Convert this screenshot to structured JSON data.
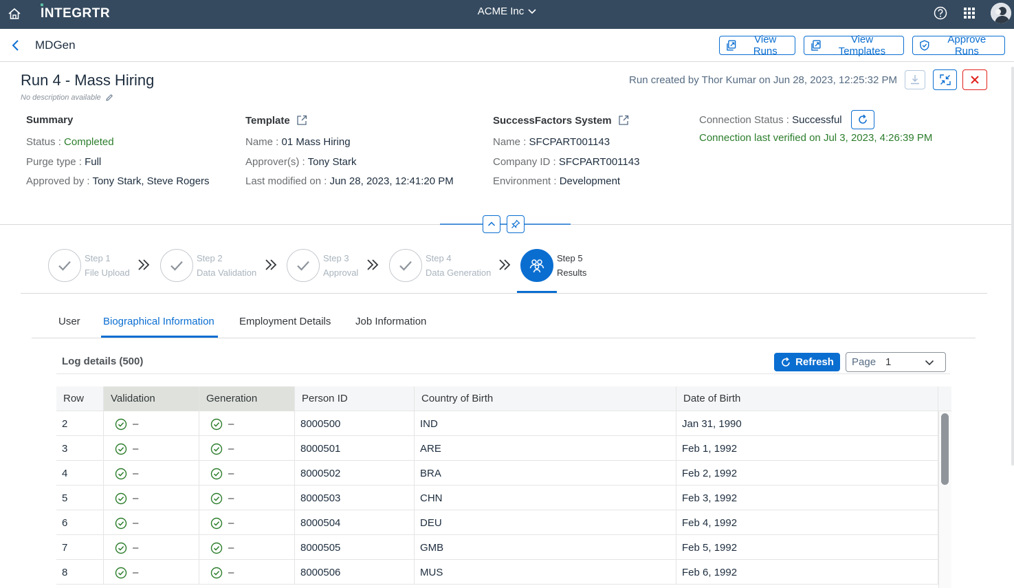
{
  "shell": {
    "brand": "INTEGRTR",
    "tenant": "ACME Inc"
  },
  "subheader": {
    "app_title": "MDGen",
    "buttons": {
      "view_runs": "View Runs",
      "view_templates": "View Templates",
      "approve_runs": "Approve Runs"
    }
  },
  "run": {
    "title": "Run 4 - Mass Hiring",
    "description": "No description available",
    "created": "Run created by Thor Kumar on Jun 28, 2023, 12:25:32 PM"
  },
  "summary": {
    "title": "Summary",
    "status_label": "Status :",
    "status_value": "Completed",
    "purge_label": "Purge type :",
    "purge_value": "Full",
    "approved_label": "Approved by :",
    "approved_value": "Tony Stark, Steve Rogers"
  },
  "template": {
    "title": "Template",
    "name_label": "Name :",
    "name_value": "01 Mass Hiring",
    "approvers_label": "Approver(s) :",
    "approvers_value": "Tony Stark",
    "modified_label": "Last modified on :",
    "modified_value": "Jun 28, 2023, 12:41:20 PM"
  },
  "system": {
    "title": "SuccessFactors System",
    "name_label": "Name :",
    "name_value": "SFCPART001143",
    "company_label": "Company ID :",
    "company_value": "SFCPART001143",
    "env_label": "Environment :",
    "env_value": "Development"
  },
  "connection": {
    "label": "Connection Status :",
    "value": "Successful",
    "verified": "Connection last verified on Jul 3, 2023, 4:26:39 PM"
  },
  "steps": [
    {
      "num": "Step 1",
      "name": "File Upload",
      "state": "done"
    },
    {
      "num": "Step 2",
      "name": "Data Validation",
      "state": "done"
    },
    {
      "num": "Step 3",
      "name": "Approval",
      "state": "done"
    },
    {
      "num": "Step 4",
      "name": "Data Generation",
      "state": "done"
    },
    {
      "num": "Step 5",
      "name": "Results",
      "state": "active"
    }
  ],
  "tabs": [
    {
      "label": "User"
    },
    {
      "label": "Biographical Information",
      "active": true
    },
    {
      "label": "Employment Details"
    },
    {
      "label": "Job Information"
    }
  ],
  "log": {
    "title": "Log details (500)",
    "refresh": "Refresh",
    "page_label": "Page",
    "page_value": "1"
  },
  "table": {
    "headers": [
      "Row",
      "Validation",
      "Generation",
      "Person ID",
      "Country of Birth",
      "Date of Birth"
    ],
    "dash": "–",
    "rows": [
      {
        "row": "2",
        "person_id": "8000500",
        "country": "IND",
        "dob": "Jan 31, 1990"
      },
      {
        "row": "3",
        "person_id": "8000501",
        "country": "ARE",
        "dob": "Feb 1, 1992"
      },
      {
        "row": "4",
        "person_id": "8000502",
        "country": "BRA",
        "dob": "Feb 2, 1992"
      },
      {
        "row": "5",
        "person_id": "8000503",
        "country": "CHN",
        "dob": "Feb 3, 1992"
      },
      {
        "row": "6",
        "person_id": "8000504",
        "country": "DEU",
        "dob": "Feb 4, 1992"
      },
      {
        "row": "7",
        "person_id": "8000505",
        "country": "GMB",
        "dob": "Feb 5, 1992"
      },
      {
        "row": "8",
        "person_id": "8000506",
        "country": "MUS",
        "dob": "Feb 6, 1992"
      }
    ]
  },
  "colors": {
    "shell": "#354a5f",
    "accent": "#0a6ed1",
    "success": "#2b7d2b",
    "danger": "#e0201a"
  }
}
